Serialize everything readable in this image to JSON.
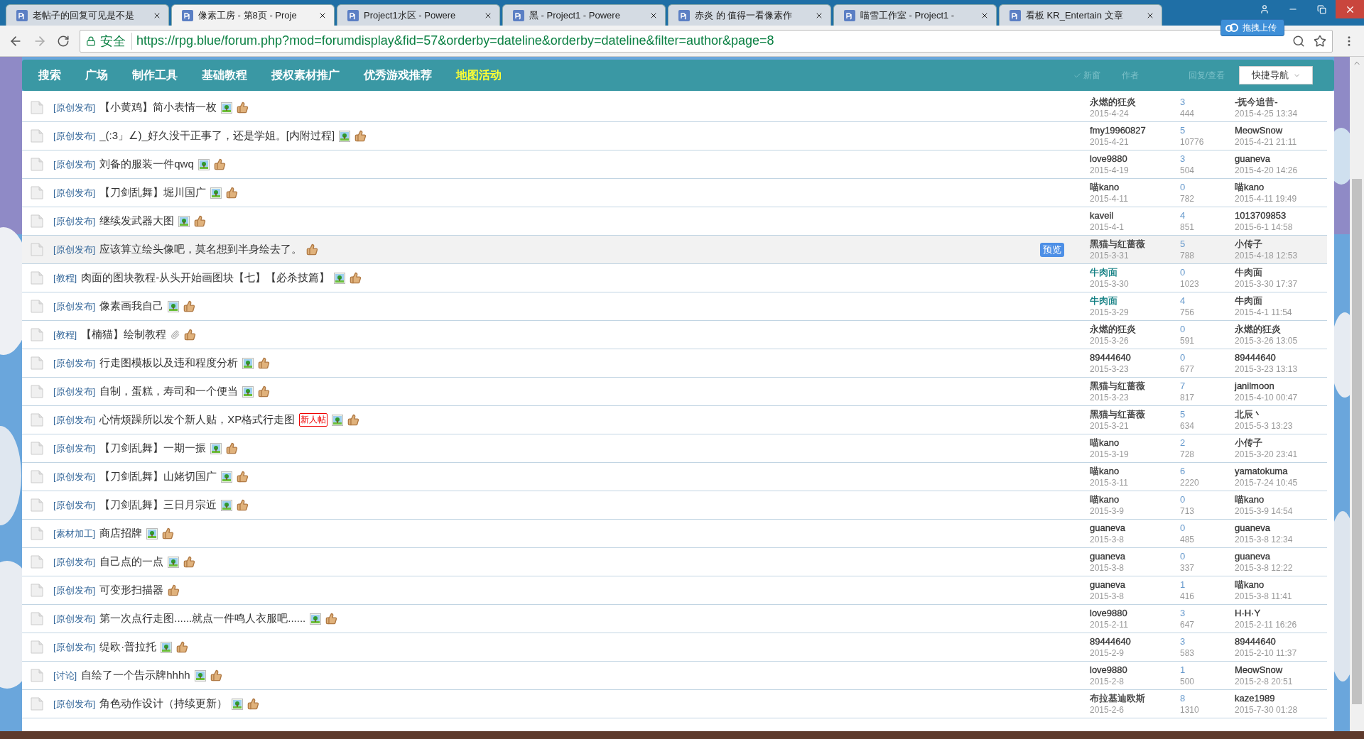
{
  "browser": {
    "tabs": [
      {
        "title": "老帖子的回复可见是不是",
        "selected": false
      },
      {
        "title": "像素工房 - 第8页 - Proje",
        "selected": true
      },
      {
        "title": "Project1水区 - Powere",
        "selected": false
      },
      {
        "title": "黑 - Project1 - Powere",
        "selected": false
      },
      {
        "title": "赤炎 的 值得一看像素作",
        "selected": false
      },
      {
        "title": "喵雪工作室 - Project1 -",
        "selected": false
      },
      {
        "title": "看板 KR_Entertain 文章",
        "selected": false
      }
    ],
    "secure_label": "安全",
    "url": "https://rpg.blue/forum.php?mod=forumdisplay&fid=57&orderby=dateline&orderby=dateline&filter=author&page=8",
    "upload_button": "拖拽上传"
  },
  "nav": {
    "items": [
      {
        "label": "搜索",
        "highlighted": false
      },
      {
        "label": "广场",
        "highlighted": false
      },
      {
        "label": "制作工具",
        "highlighted": false
      },
      {
        "label": "基础教程",
        "highlighted": false
      },
      {
        "label": "授权素材推广",
        "highlighted": false
      },
      {
        "label": "优秀游戏推荐",
        "highlighted": false
      },
      {
        "label": "地图活动",
        "highlighted": true
      }
    ],
    "header": {
      "new_window": "新窗",
      "author": "作者",
      "replies_views": "回复/查看"
    },
    "quick_nav": "快捷导航"
  },
  "threads": [
    {
      "type": "[原创发布]",
      "title": "【小黄鸡】简小表情一枚",
      "image": true,
      "attachment": false,
      "author": "永燃的狂炎",
      "color": "#333333",
      "date": "2015-4-24",
      "replies": "3",
      "views": "444",
      "last_poster": "-抚今追昔-",
      "last_time": "2015-4-25 13:34",
      "hovered": false
    },
    {
      "type": "[原创发布]",
      "title": "_(:3」∠)_好久没干正事了，还是学姐。[内附过程]",
      "image": true,
      "attachment": false,
      "author": "fmy19960827",
      "color": "#333333",
      "date": "2015-4-21",
      "replies": "5",
      "views": "10776",
      "last_poster": "MeowSnow",
      "last_time": "2015-4-21 21:11",
      "hovered": false
    },
    {
      "type": "[原创发布]",
      "title": "刘备的服装一件qwq",
      "image": true,
      "attachment": false,
      "author": "love9880",
      "color": "#333333",
      "date": "2015-4-19",
      "replies": "3",
      "views": "504",
      "last_poster": "guaneva",
      "last_time": "2015-4-20 14:26",
      "hovered": false
    },
    {
      "type": "[原创发布]",
      "title": "【刀剑乱舞】堀川国广",
      "image": true,
      "attachment": false,
      "author": "喵kano",
      "color": "#333333",
      "date": "2015-4-11",
      "replies": "0",
      "views": "782",
      "last_poster": "喵kano",
      "last_time": "2015-4-11 19:49",
      "hovered": false
    },
    {
      "type": "[原创发布]",
      "title": "继续发武器大图",
      "image": true,
      "attachment": false,
      "author": "kaveil",
      "color": "#333333",
      "date": "2015-4-1",
      "replies": "4",
      "views": "851",
      "last_poster": "1013709853",
      "last_time": "2015-6-1 14:58",
      "hovered": false
    },
    {
      "type": "[原创发布]",
      "title": "应该算立绘头像吧，莫名想到半身绘去了。",
      "image": false,
      "attachment": false,
      "author": "黑猫与红蔷薇",
      "color": "#333333",
      "date": "2015-3-31",
      "replies": "5",
      "views": "788",
      "last_poster": "小传子",
      "last_time": "2015-4-18 12:53",
      "hovered": true,
      "preview_button": "预览"
    },
    {
      "type": "[教程]",
      "title": "肉面的图块教程-从头开始画图块【七】【必杀技篇】",
      "image": true,
      "attachment": false,
      "author": "牛肉面",
      "color": "#00767a",
      "date": "2015-3-30",
      "replies": "0",
      "views": "1023",
      "last_poster": "牛肉面",
      "last_time": "2015-3-30 17:37",
      "hovered": false
    },
    {
      "type": "[原创发布]",
      "title": "像素画我自己",
      "image": true,
      "attachment": false,
      "author": "牛肉面",
      "color": "#00767a",
      "date": "2015-3-29",
      "replies": "4",
      "views": "756",
      "last_poster": "牛肉面",
      "last_time": "2015-4-1 11:54",
      "hovered": false
    },
    {
      "type": "[教程]",
      "title": "【楠猫】绘制教程",
      "image": false,
      "attachment": true,
      "author": "永燃的狂炎",
      "color": "#333333",
      "date": "2015-3-26",
      "replies": "0",
      "views": "591",
      "last_poster": "永燃的狂炎",
      "last_time": "2015-3-26 13:05",
      "hovered": false
    },
    {
      "type": "[原创发布]",
      "title": "行走图模板以及违和程度分析",
      "image": true,
      "attachment": false,
      "author": "89444640",
      "color": "#333333",
      "date": "2015-3-23",
      "replies": "0",
      "views": "677",
      "last_poster": "89444640",
      "last_time": "2015-3-23 13:13",
      "hovered": false
    },
    {
      "type": "[原创发布]",
      "title": "自制，蛋糕，寿司和一个便当",
      "image": true,
      "attachment": false,
      "author": "黑猫与红蔷薇",
      "color": "#333333",
      "date": "2015-3-23",
      "replies": "7",
      "views": "817",
      "last_poster": "janilmoon",
      "last_time": "2015-4-10 00:47",
      "hovered": false
    },
    {
      "type": "[原创发布]",
      "title": "心情烦躁所以发个新人贴，XP格式行走图",
      "badge": "新人帖",
      "image": true,
      "attachment": false,
      "author": "黑猫与红蔷薇",
      "color": "#333333",
      "date": "2015-3-21",
      "replies": "5",
      "views": "634",
      "last_poster": "北辰丶",
      "last_time": "2015-5-3 13:23",
      "hovered": false
    },
    {
      "type": "[原创发布]",
      "title": "【刀剑乱舞】一期一振",
      "image": true,
      "attachment": false,
      "author": "喵kano",
      "color": "#333333",
      "date": "2015-3-19",
      "replies": "2",
      "views": "728",
      "last_poster": "小传子",
      "last_time": "2015-3-20 23:41",
      "hovered": false
    },
    {
      "type": "[原创发布]",
      "title": "【刀剑乱舞】山姥切国广",
      "image": true,
      "attachment": false,
      "author": "喵kano",
      "color": "#333333",
      "date": "2015-3-11",
      "replies": "6",
      "views": "2220",
      "last_poster": "yamatokuma",
      "last_time": "2015-7-24 10:45",
      "hovered": false
    },
    {
      "type": "[原创发布]",
      "title": "【刀剑乱舞】三日月宗近",
      "image": true,
      "attachment": false,
      "author": "喵kano",
      "color": "#333333",
      "date": "2015-3-9",
      "replies": "0",
      "views": "713",
      "last_poster": "喵kano",
      "last_time": "2015-3-9 14:54",
      "hovered": false
    },
    {
      "type": "[素材加工]",
      "title": "商店招牌",
      "image": true,
      "attachment": false,
      "author": "guaneva",
      "color": "#333333",
      "date": "2015-3-8",
      "replies": "0",
      "views": "485",
      "last_poster": "guaneva",
      "last_time": "2015-3-8 12:34",
      "hovered": false
    },
    {
      "type": "[原创发布]",
      "title": "自己点的一点",
      "image": true,
      "attachment": false,
      "author": "guaneva",
      "color": "#333333",
      "date": "2015-3-8",
      "replies": "0",
      "views": "337",
      "last_poster": "guaneva",
      "last_time": "2015-3-8 12:22",
      "hovered": false
    },
    {
      "type": "[原创发布]",
      "title": "可变形扫描器",
      "image": false,
      "attachment": false,
      "author": "guaneva",
      "color": "#333333",
      "date": "2015-3-8",
      "replies": "1",
      "views": "416",
      "last_poster": "喵kano",
      "last_time": "2015-3-8 11:41",
      "hovered": false
    },
    {
      "type": "[原创发布]",
      "title": "第一次点行走图......就点一件鸣人衣服吧......",
      "image": true,
      "attachment": false,
      "author": "love9880",
      "color": "#333333",
      "date": "2015-2-11",
      "replies": "3",
      "views": "647",
      "last_poster": "H·H·Y",
      "last_time": "2015-2-11 16:26",
      "hovered": false
    },
    {
      "type": "[原创发布]",
      "title": "缇欧·普拉托",
      "image": true,
      "attachment": false,
      "author": "89444640",
      "color": "#333333",
      "date": "2015-2-9",
      "replies": "3",
      "views": "583",
      "last_poster": "89444640",
      "last_time": "2015-2-10 11:37",
      "hovered": false
    },
    {
      "type": "[讨论]",
      "title": "自绘了一个告示牌hhhh",
      "image": true,
      "attachment": false,
      "author": "love9880",
      "color": "#333333",
      "date": "2015-2-8",
      "replies": "1",
      "views": "500",
      "last_poster": "MeowSnow",
      "last_time": "2015-2-8 20:51",
      "hovered": false
    },
    {
      "type": "[原创发布]",
      "title": "角色动作设计（持续更新）",
      "image": true,
      "attachment": false,
      "author": "布拉基迪欧斯",
      "color": "#333333",
      "date": "2015-2-6",
      "replies": "8",
      "views": "1310",
      "last_poster": "kaze1989",
      "last_time": "2015-7-30 01:28",
      "hovered": false
    }
  ]
}
